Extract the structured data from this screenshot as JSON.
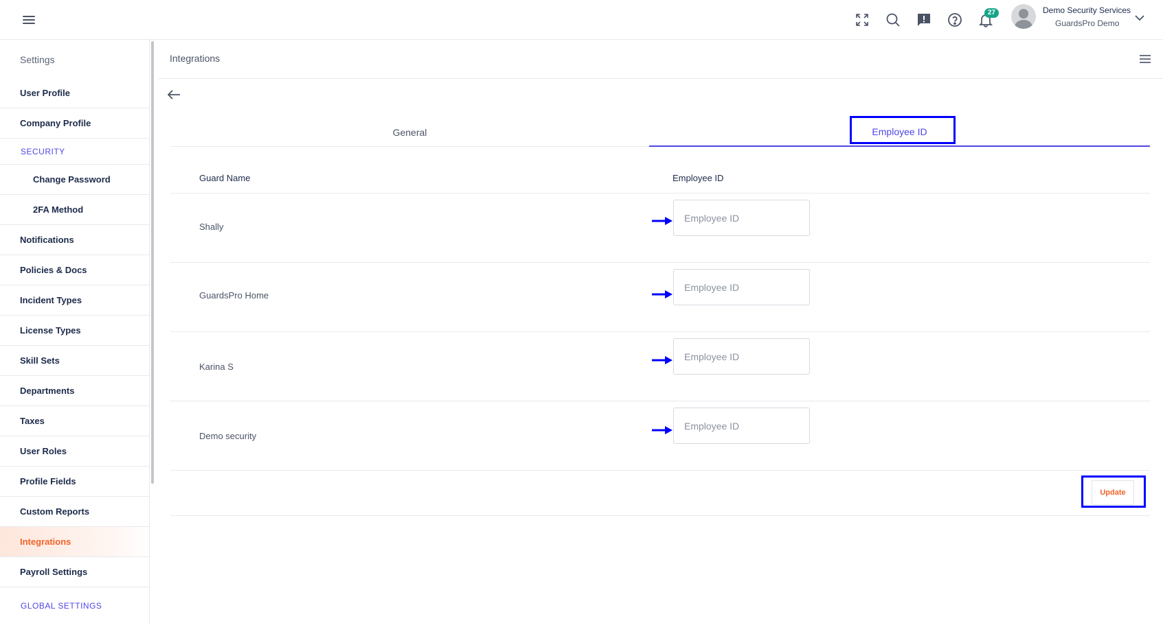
{
  "header": {
    "user_name": "Demo Security Services",
    "user_company": "GuardsPro Demo",
    "notifications_count": "27",
    "icons": [
      "hamburger-icon",
      "fullscreen-icon",
      "search-icon",
      "feedback-icon",
      "help-icon",
      "bell-icon",
      "avatar",
      "chevron-down-icon"
    ]
  },
  "sidebar": {
    "title": "Settings",
    "items": [
      {
        "label": "User Profile"
      },
      {
        "label": "Company Profile"
      },
      {
        "label": "SECURITY"
      },
      {
        "label": "Change Password"
      },
      {
        "label": "2FA Method"
      },
      {
        "label": "Notifications"
      },
      {
        "label": "Policies & Docs"
      },
      {
        "label": "Incident Types"
      },
      {
        "label": "License Types"
      },
      {
        "label": "Skill Sets"
      },
      {
        "label": "Departments"
      },
      {
        "label": "Taxes"
      },
      {
        "label": "User Roles"
      },
      {
        "label": "Profile Fields"
      },
      {
        "label": "Custom Reports"
      },
      {
        "label": "Integrations"
      },
      {
        "label": "Payroll Settings"
      },
      {
        "label": "GLOBAL SETTINGS"
      }
    ],
    "active": "Integrations"
  },
  "main": {
    "title": "Integrations",
    "tabs": [
      {
        "label": "General"
      },
      {
        "label": "Employee ID"
      }
    ],
    "active_tab": "Employee ID",
    "columns": [
      "Guard Name",
      "Employee ID"
    ],
    "rows": [
      {
        "guard": "Shally",
        "employee_id": "",
        "placeholder": "Employee ID"
      },
      {
        "guard": "GuardsPro Home",
        "employee_id": "",
        "placeholder": "Employee ID"
      },
      {
        "guard": "Karina S",
        "employee_id": "",
        "placeholder": "Employee ID"
      },
      {
        "guard": "Demo security",
        "employee_id": "",
        "placeholder": "Employee ID"
      }
    ],
    "update_label": "Update"
  },
  "colors": {
    "accent": "#4f46e5",
    "active_orange": "#f0642a",
    "badge_green": "#17a589",
    "annotation_blue": "#0000ff"
  }
}
